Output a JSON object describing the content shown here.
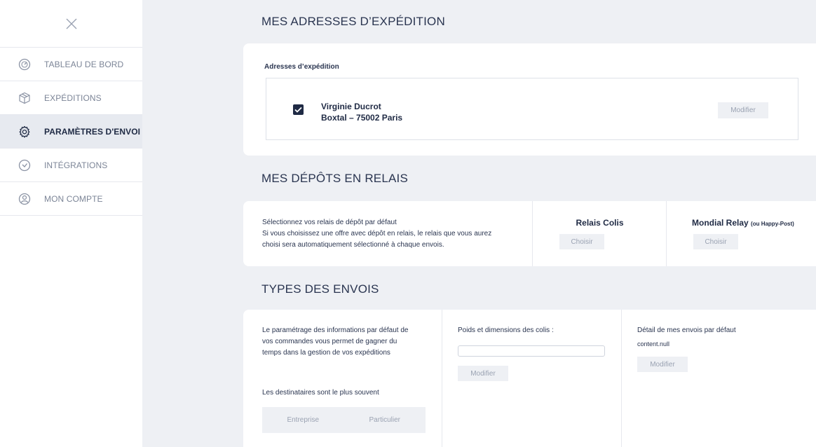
{
  "sidebar": {
    "items": [
      {
        "label": "TABLEAU DE BORD",
        "icon": "gauge-icon"
      },
      {
        "label": "EXPÉDITIONS",
        "icon": "box-icon"
      },
      {
        "label": "PARAMÈTRES D'ENVOI",
        "icon": "gear-icon",
        "active": true
      },
      {
        "label": "INTÉGRATIONS",
        "icon": "plug-icon"
      },
      {
        "label": "MON COMPTE",
        "icon": "user-icon"
      }
    ]
  },
  "shipping": {
    "title": "MES ADRESSES D’EXPÉDITION",
    "card_label": "Adresses d’expédition",
    "address": {
      "name": "Virginie Ducrot",
      "line": "Boxtal – 75002 Paris",
      "checked": true
    },
    "edit_label": "Modifier"
  },
  "relays": {
    "title": "MES DÉPÔTS EN RELAIS",
    "text_line1": "Sélectionnez vos relais de dépôt par défaut",
    "text_line2": "Si vous choisissez une offre avec dépôt en relais, le relais que vous aurez",
    "text_line3": "choisi sera automatiquement sélectionné à chaque envois.",
    "relais_colis_label": "Relais Colis",
    "mondial_label": "Mondial Relay",
    "mondial_suffix": "(ou Happy-Post)",
    "choose_label": "Choisir"
  },
  "types": {
    "title": "TYPES DES ENVOIS",
    "desc_line1": "Le paramétrage des informations par défaut de",
    "desc_line2": "vos commandes vous permet de gagner du",
    "desc_line3": "temps dans la gestion de vos expéditions",
    "recipients_label": "Les destinataires sont le plus souvent",
    "option_company": "Entreprise",
    "option_individual": "Particulier",
    "weight_label": "Poids et dimensions des colis :",
    "weight_value": "",
    "details_label": "Détail de mes envois par défaut",
    "details_value": "content.null",
    "edit_label": "Modifier"
  },
  "colors": {
    "navy": "#1f2a44",
    "muted": "#7c8597",
    "background": "#eef0f4"
  }
}
